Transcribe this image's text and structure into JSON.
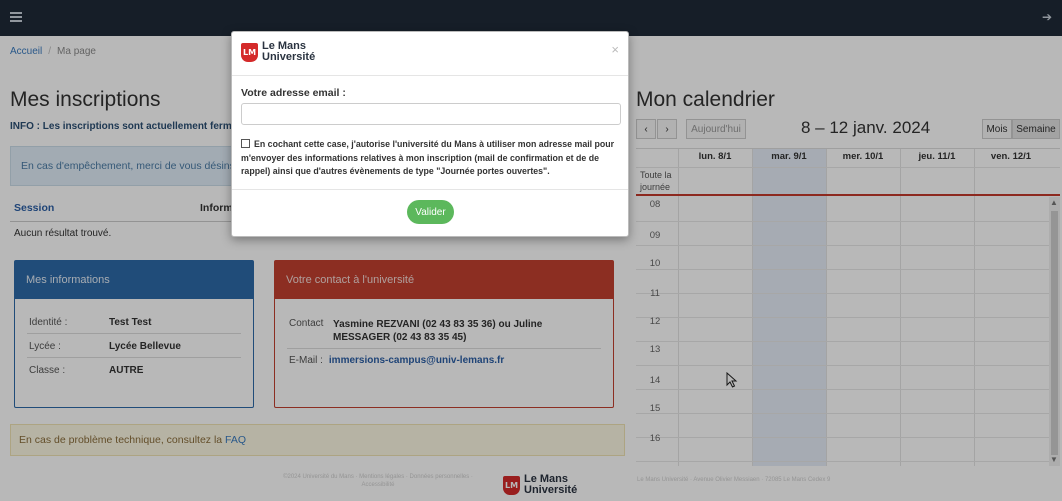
{
  "topbar": {
    "menu_icon": "hamburger-icon",
    "logout_icon": "logout-icon"
  },
  "breadcrumb": {
    "home": "Accueil",
    "current": "Ma page"
  },
  "inscriptions": {
    "title": "Mes inscriptions",
    "info": "INFO : Les inscriptions sont actuellement ferm",
    "warning": "En cas d'empêchement, merci de vous désinscri",
    "columns": [
      "Session",
      "Inform"
    ],
    "empty": "Aucun résultat trouvé."
  },
  "mes_infos": {
    "title": "Mes informations",
    "rows": [
      {
        "label": "Identité :",
        "value": "Test Test"
      },
      {
        "label": "Lycée :",
        "value": "Lycée Bellevue"
      },
      {
        "label": "Classe :",
        "value": "AUTRE"
      }
    ]
  },
  "contact": {
    "title": "Votre contact à l'université",
    "contact_label": "Contact",
    "contact_value": "Yasmine REZVANI (02 43 83 35 36) ou Juline MESSAGER (02 43 83 35 45)",
    "email_label": "E-Mail :",
    "email_value": "immersions-campus@univ-lemans.fr"
  },
  "faq": {
    "text": "En cas de problème technique, consultez la",
    "link": "FAQ"
  },
  "footer": {
    "left": "©2024 Université du Mans · Mentions légales · Données personnelles · Accessibilité",
    "right": "Le Mans Université · Avenue Olivier Messiaen · 72085 Le Mans Cedex 9",
    "logo_line1": "Le Mans",
    "logo_line2": "Université"
  },
  "calendar": {
    "title": "Mon calendrier",
    "prev": "‹",
    "next": "›",
    "today": "Aujourd'hui",
    "range": "8 – 12 janv. 2024",
    "view_month": "Mois",
    "view_week": "Semaine",
    "days": [
      "lun. 8/1",
      "mar. 9/1",
      "mer. 10/1",
      "jeu. 11/1",
      "ven. 12/1"
    ],
    "allday_line1": "Toute la",
    "allday_line2": "journée",
    "hours": [
      "08",
      "09",
      "10",
      "11",
      "12",
      "13",
      "14",
      "15",
      "16"
    ]
  },
  "modal": {
    "logo_line1": "Le Mans",
    "logo_line2": "Université",
    "close": "×",
    "email_label": "Votre adresse email :",
    "email_value": "",
    "consent": "En cochant cette case, j'autorise l'université du Mans à utiliser mon adresse mail pour m'envoyer des informations relatives à mon inscription (mail de confirmation et de de rappel) ainsi que d'autres évènements de type \"Journée portes ouvertes\".",
    "submit": "Valider"
  },
  "colors": {
    "topbar": "#1f2a38",
    "blue_panel": "#2d6aa8",
    "red_panel": "#c24030",
    "button_green": "#5cb85c",
    "brand_red": "#d42a2a"
  }
}
